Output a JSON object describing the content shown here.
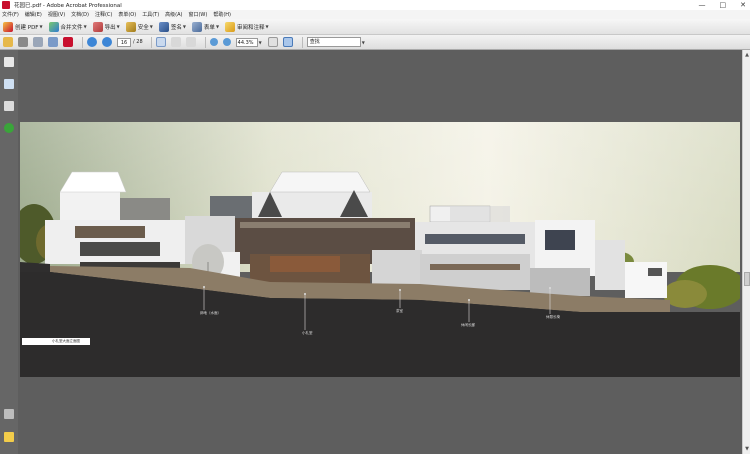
{
  "window": {
    "title": "花园已.pdf - Adobe Acrobat Professional",
    "controls": [
      "—",
      "□",
      "✕"
    ]
  },
  "menu": [
    "文件(F)",
    "编辑(E)",
    "视图(V)",
    "文档(D)",
    "注释(C)",
    "表单(O)",
    "工具(T)",
    "高级(A)",
    "窗口(W)",
    "帮助(H)"
  ],
  "toolbar": {
    "create_pdf": "创建 PDF",
    "merge": "合并文件",
    "export": "导出",
    "security": "安全",
    "sign": "签名",
    "forms": "表单",
    "review": "审阅和注释"
  },
  "nav": {
    "page_current": "16",
    "page_total": "/ 28",
    "zoom": "44.3%",
    "search_placeholder": "查找"
  },
  "drawing": {
    "labels": [
      "卵地（水面）",
      "小礼堂",
      "茶室",
      "休闲长廊",
      "休憩长椅"
    ],
    "caption": "小礼堂大面立面图"
  },
  "colors": {
    "accent": "#1e5fb3",
    "pdf_red": "#c8102e"
  }
}
